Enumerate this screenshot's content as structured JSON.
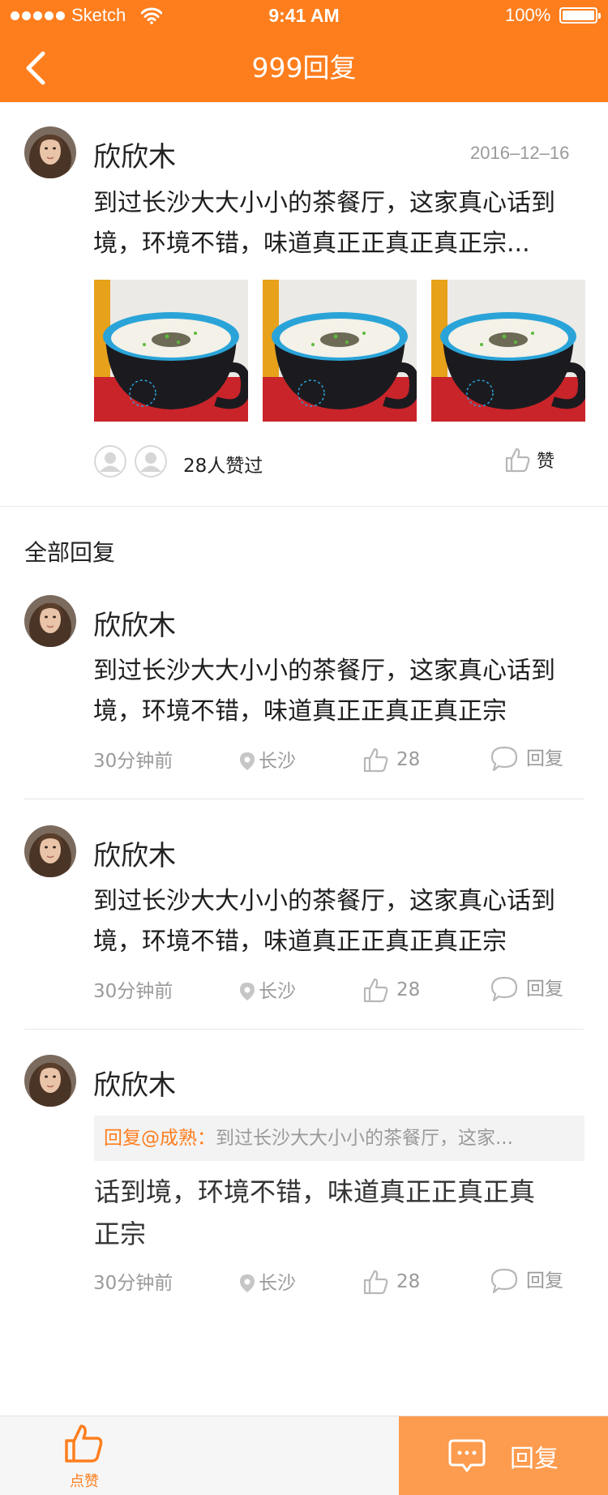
{
  "status_bar": {
    "carrier": "Sketch",
    "time": "9:41 AM",
    "battery": "100%"
  },
  "nav": {
    "title": "999回复",
    "back_icon": "chevron-left-icon"
  },
  "post": {
    "author": "欣欣木",
    "date": "2016–12–16",
    "text_line1": "到过长沙大大小小的茶餐厅，这家真心话到",
    "text_line2": "境，环境不错，味道真正正真正真正宗...",
    "photo_count": 3,
    "likes_text": "28人赞过",
    "like_label": "赞"
  },
  "replies_section": {
    "title": "全部回复"
  },
  "replies": [
    {
      "author": "欣欣木",
      "text_line1": "到过长沙大大小小的茶餐厅，这家真心话到",
      "text_line2": "境，环境不错，味道真正正真正真正宗",
      "time": "30分钟前",
      "location": "长沙",
      "likes": "28",
      "reply_label": "回复"
    },
    {
      "author": "欣欣木",
      "text_line1": "到过长沙大大小小的茶餐厅，这家真心话到",
      "text_line2": "境，环境不错，味道真正正真正真正宗",
      "time": "30分钟前",
      "location": "长沙",
      "likes": "28",
      "reply_label": "回复"
    },
    {
      "author": "欣欣木",
      "quote_prefix": "回复@成熟：",
      "quote_text": "到过长沙大大小小的茶餐厅，这家...",
      "text_line1": "话到境，环境不错，味道真正正真正真",
      "text_line2": "正宗",
      "time": "30分钟前",
      "location": "长沙",
      "likes": "28",
      "reply_label": "回复"
    }
  ],
  "bottom_bar": {
    "like_label": "点赞",
    "reply_label": "回复"
  },
  "colors": {
    "brand_orange": "#fe7e1e",
    "reply_button": "#fd9b4e",
    "muted_text": "#9a9a9a"
  }
}
